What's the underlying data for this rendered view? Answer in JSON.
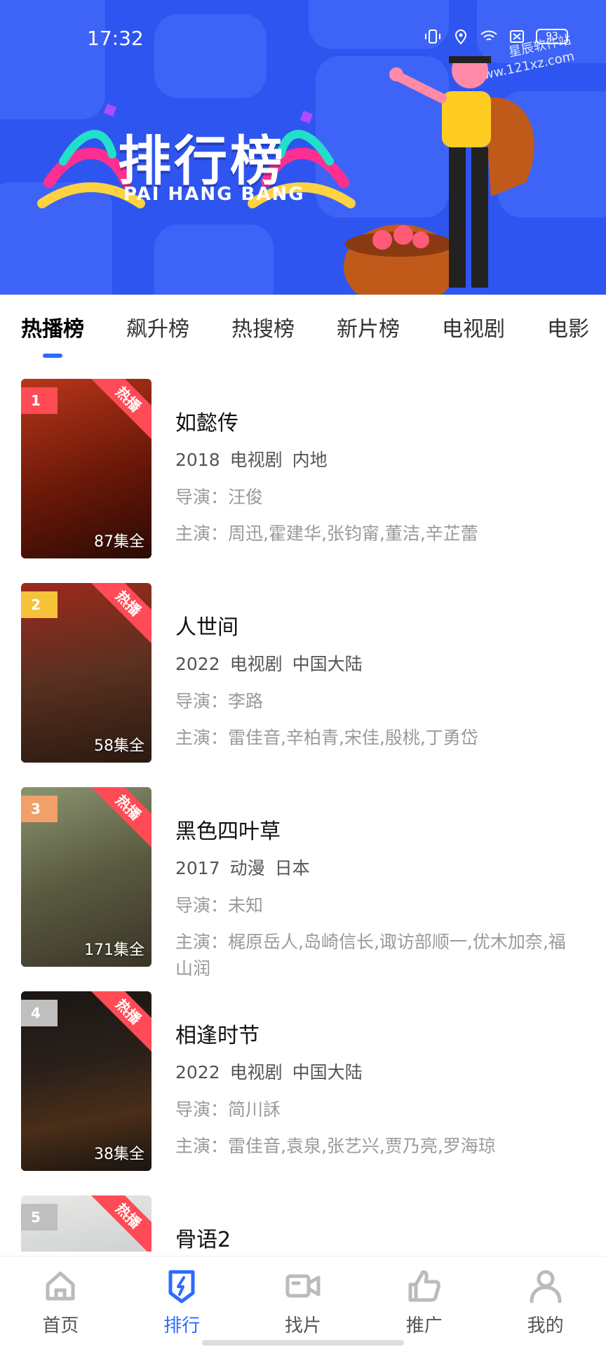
{
  "status_bar": {
    "time": "17:32",
    "battery": "93"
  },
  "banner": {
    "title_cn": "排行榜",
    "title_en": "PAI HANG BANG",
    "watermark_line1": "星辰软件站",
    "watermark_line2": "www.121xz.com"
  },
  "tabs": [
    {
      "label": "热播榜"
    },
    {
      "label": "飙升榜"
    },
    {
      "label": "热搜榜"
    },
    {
      "label": "新片榜"
    },
    {
      "label": "电视剧"
    },
    {
      "label": "电影"
    }
  ],
  "items": [
    {
      "rank": "1",
      "badge": "热播",
      "episodes": "87集全",
      "title": "如懿传",
      "year": "2018",
      "type": "电视剧",
      "region": "内地",
      "director": "导演：汪俊",
      "cast": "主演：周迅,霍建华,张钧甯,董洁,辛芷蕾",
      "rank_color": "#ff4b55"
    },
    {
      "rank": "2",
      "badge": "热播",
      "episodes": "58集全",
      "title": "人世间",
      "year": "2022",
      "type": "电视剧",
      "region": "中国大陆",
      "director": "导演：李路",
      "cast": "主演：雷佳音,辛柏青,宋佳,殷桃,丁勇岱",
      "rank_color": "#f5c23a"
    },
    {
      "rank": "3",
      "badge": "热播",
      "episodes": "171集全",
      "title": "黑色四叶草",
      "year": "2017",
      "type": "动漫",
      "region": "日本",
      "director": "导演：未知",
      "cast": "主演：梶原岳人,岛崎信长,诹访部顺一,优木加奈,福山润",
      "rank_color": "#f0a068"
    },
    {
      "rank": "4",
      "badge": "热播",
      "episodes": "38集全",
      "title": "相逢时节",
      "year": "2022",
      "type": "电视剧",
      "region": "中国大陆",
      "director": "导演：简川訸",
      "cast": "主演：雷佳音,袁泉,张艺兴,贾乃亮,罗海琼",
      "rank_color": "#bfbfbf"
    },
    {
      "rank": "5",
      "badge": "热播",
      "episodes": "",
      "title": "骨语2",
      "year": "",
      "type": "",
      "region": "",
      "director": "",
      "cast": "",
      "rank_color": "#bfbfbf"
    }
  ],
  "bottom_nav": [
    {
      "label": "首页",
      "icon": "home-icon"
    },
    {
      "label": "排行",
      "icon": "ranking-icon"
    },
    {
      "label": "找片",
      "icon": "video-camera-icon"
    },
    {
      "label": "推广",
      "icon": "thumbs-up-icon"
    },
    {
      "label": "我的",
      "icon": "user-icon"
    }
  ],
  "colors": {
    "accent": "#2c6bff",
    "banner_bg": "#2f55f0",
    "hot_badge": "#ff4b55"
  }
}
